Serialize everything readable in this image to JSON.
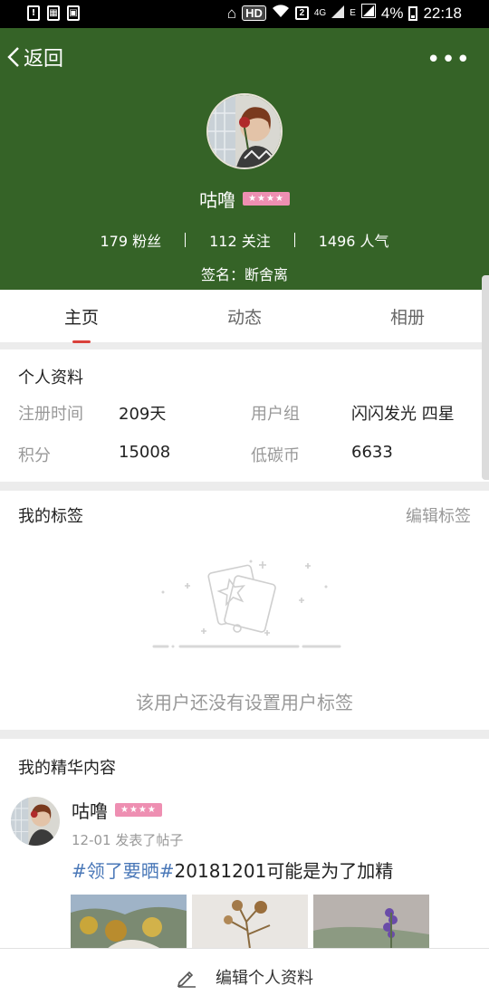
{
  "status_bar": {
    "time": "22:18",
    "battery": "4%",
    "network": "HD",
    "sim": "2",
    "net_type": "4G",
    "net_e": "E"
  },
  "header": {
    "back_label": "返回",
    "more_icon": "more-icon",
    "username": "咕噜",
    "badge": "★★★★",
    "stats": {
      "fans": "179 粉丝",
      "following": "112 关注",
      "popularity": "1496 人气"
    },
    "signature": "签名：断舍离"
  },
  "tabs": [
    {
      "label": "主页",
      "active": true
    },
    {
      "label": "动态",
      "active": false
    },
    {
      "label": "相册",
      "active": false
    }
  ],
  "profile": {
    "title": "个人资料",
    "reg_label": "注册时间",
    "reg_value": "209天",
    "group_label": "用户组",
    "group_value": "闪闪发光 四星",
    "points_label": "积分",
    "points_value": "15008",
    "coin_label": "低碳币",
    "coin_value": "6633"
  },
  "tags": {
    "title": "我的标签",
    "edit_label": "编辑标签",
    "empty_text": "该用户还没有设置用户标签"
  },
  "featured": {
    "title": "我的精华内容",
    "post": {
      "username": "咕噜",
      "badge": "★★★★",
      "meta": "12-01  发表了帖子",
      "hashtag": "#领了要晒#",
      "title_rest": "20181201可能是为了加精"
    }
  },
  "bottom": {
    "edit_label": "编辑个人资料"
  },
  "colors": {
    "header_bg": "#356327",
    "accent": "#d9403a",
    "badge": "#ee8fb2",
    "hashtag": "#4a78b8"
  }
}
